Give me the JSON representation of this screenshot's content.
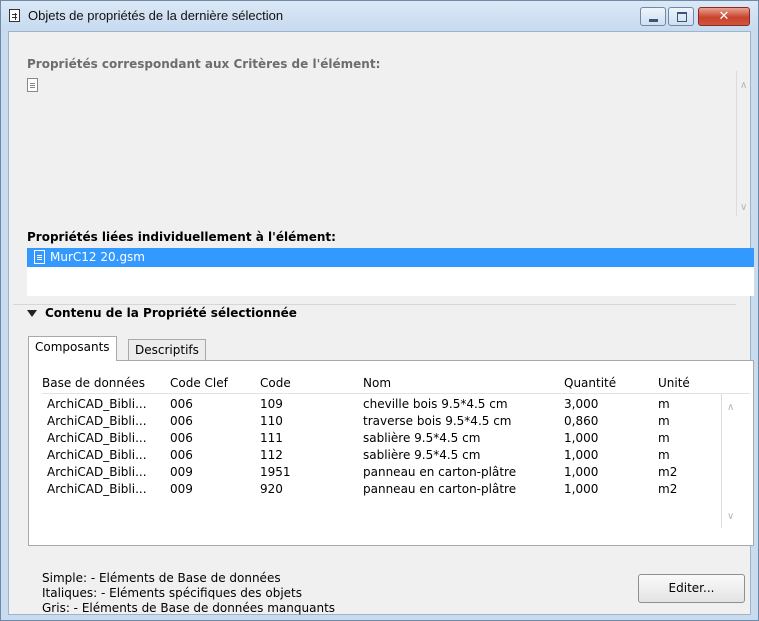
{
  "window": {
    "title": "Objets de propriétés de la dernière sélection",
    "close_glyph": "✕"
  },
  "criteria": {
    "label": "Propriétés correspondant aux Critères de l'élément:"
  },
  "linked": {
    "label": "Propriétés liées individuellement à l'élément:",
    "items": [
      {
        "label": "MurC12 20.gsm",
        "icon": "document-icon"
      }
    ]
  },
  "content_section": {
    "label": "Contenu de la Propriété sélectionnée"
  },
  "tabs": [
    {
      "label": "Composants",
      "active": true
    },
    {
      "label": "Descriptifs",
      "active": false
    }
  ],
  "table": {
    "columns": [
      "Base de données",
      "Code Clef",
      "Code",
      "Nom",
      "Quantité",
      "Unité"
    ],
    "rows": [
      [
        "ArchiCAD_Bibli...",
        "006",
        "109",
        "cheville bois 9.5*4.5 cm",
        "3,000",
        "m"
      ],
      [
        "ArchiCAD_Bibli...",
        "006",
        "110",
        "traverse bois 9.5*4.5 cm",
        "0,860",
        "m"
      ],
      [
        "ArchiCAD_Bibli...",
        "006",
        "111",
        "sablière 9.5*4.5 cm",
        "1,000",
        "m"
      ],
      [
        "ArchiCAD_Bibli...",
        "006",
        "112",
        "sablière 9.5*4.5 cm",
        "1,000",
        "m"
      ],
      [
        "ArchiCAD_Bibli...",
        "009",
        "1951",
        "panneau en carton-plâtre",
        "1,000",
        "m2"
      ],
      [
        "ArchiCAD_Bibli...",
        "009",
        "920",
        "panneau en carton-plâtre",
        "1,000",
        "m2"
      ]
    ]
  },
  "legend": {
    "simple": "Simple: - Eléments de Base de données",
    "italic": "Italiques: - Eléments spécifiques des objets",
    "gray": "Gris: - Eléments de Base de données manquants"
  },
  "buttons": {
    "edit": "Editer..."
  },
  "colors": {
    "selection": "#3399ff",
    "close_button": "#c9432c",
    "title_bar": "#c7daef"
  }
}
